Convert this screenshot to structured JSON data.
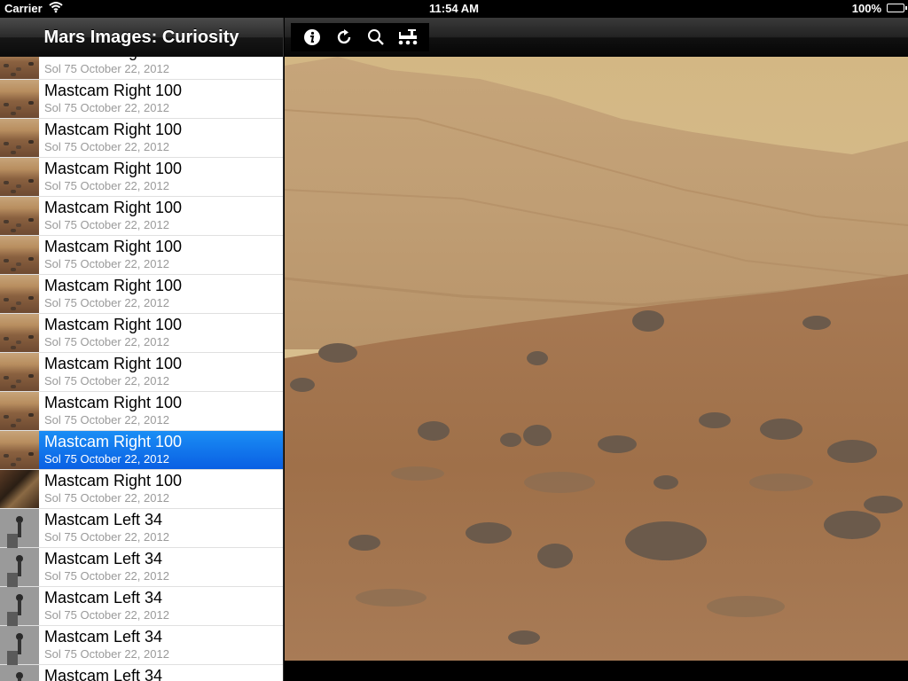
{
  "status_bar": {
    "carrier": "Carrier",
    "time": "11:54 AM",
    "battery": "100%"
  },
  "sidebar": {
    "title": "Mars Images: Curiosity",
    "items": [
      {
        "title": "Mastcam Right 100",
        "subtitle": "Sol 75  October 22, 2012",
        "thumb": "mars"
      },
      {
        "title": "Mastcam Right 100",
        "subtitle": "Sol 75  October 22, 2012",
        "thumb": "mars"
      },
      {
        "title": "Mastcam Right 100",
        "subtitle": "Sol 75  October 22, 2012",
        "thumb": "mars"
      },
      {
        "title": "Mastcam Right 100",
        "subtitle": "Sol 75  October 22, 2012",
        "thumb": "mars"
      },
      {
        "title": "Mastcam Right 100",
        "subtitle": "Sol 75  October 22, 2012",
        "thumb": "mars"
      },
      {
        "title": "Mastcam Right 100",
        "subtitle": "Sol 75  October 22, 2012",
        "thumb": "mars"
      },
      {
        "title": "Mastcam Right 100",
        "subtitle": "Sol 75  October 22, 2012",
        "thumb": "mars"
      },
      {
        "title": "Mastcam Right 100",
        "subtitle": "Sol 75  October 22, 2012",
        "thumb": "mars"
      },
      {
        "title": "Mastcam Right 100",
        "subtitle": "Sol 75  October 22, 2012",
        "thumb": "mars"
      },
      {
        "title": "Mastcam Right 100",
        "subtitle": "Sol 75  October 22, 2012",
        "thumb": "mars"
      },
      {
        "title": "Mastcam Right 100",
        "subtitle": "Sol 75  October 22, 2012",
        "thumb": "mars",
        "selected": true
      },
      {
        "title": "Mastcam Right 100",
        "subtitle": "Sol 75  October 22, 2012",
        "thumb": "dark"
      },
      {
        "title": "Mastcam Left 34",
        "subtitle": "Sol 75  October 22, 2012",
        "thumb": "gray"
      },
      {
        "title": "Mastcam Left 34",
        "subtitle": "Sol 75  October 22, 2012",
        "thumb": "gray"
      },
      {
        "title": "Mastcam Left 34",
        "subtitle": "Sol 75  October 22, 2012",
        "thumb": "gray"
      },
      {
        "title": "Mastcam Left 34",
        "subtitle": "Sol 75  October 22, 2012",
        "thumb": "gray"
      },
      {
        "title": "Mastcam Left 34",
        "subtitle": "",
        "thumb": "gray"
      }
    ]
  },
  "toolbar": {
    "icons": [
      "info-icon",
      "refresh-icon",
      "search-icon",
      "rover-icon"
    ]
  },
  "colors": {
    "selection": "#0a5fe3",
    "sky": "#d8c08f",
    "ground": "#a6764f"
  }
}
